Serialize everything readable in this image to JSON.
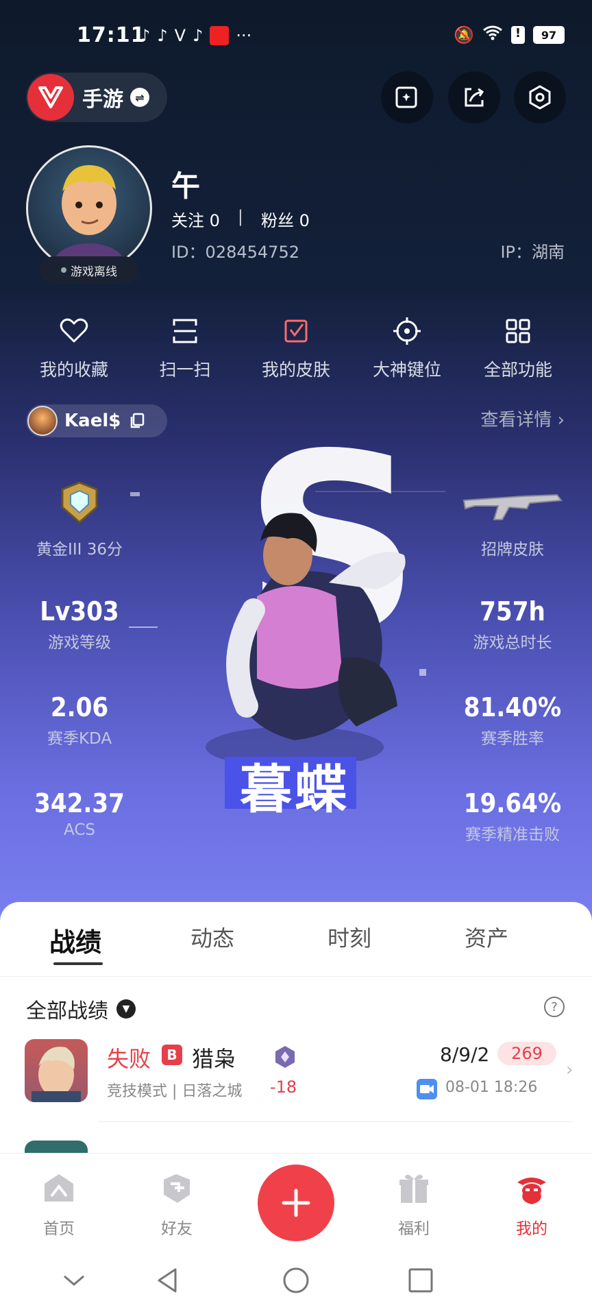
{
  "status_bar": {
    "time": "17:11",
    "battery": "97",
    "more": "···"
  },
  "header": {
    "app_name": "手游",
    "buttons": [
      "publish-icon",
      "share-icon",
      "settings-icon"
    ]
  },
  "profile": {
    "username": "午",
    "follow_label": "关注 0",
    "fans_label": "粉丝 0",
    "separator": "|",
    "id_text": "ID：028454752",
    "ip_text": "IP：湖南",
    "status": "游戏离线"
  },
  "quick_actions": [
    {
      "label": "我的收藏",
      "icon": "heart-icon"
    },
    {
      "label": "扫一扫",
      "icon": "scan-icon"
    },
    {
      "label": "我的皮肤",
      "icon": "skin-icon"
    },
    {
      "label": "大神键位",
      "icon": "crosshair-icon"
    },
    {
      "label": "全部功能",
      "icon": "grid-icon"
    }
  ],
  "account": {
    "name": "Kael$",
    "detail_link": "查看详情 ›"
  },
  "hero": {
    "agent_name": "暮蝶",
    "letter": "S"
  },
  "stats": {
    "rank_label": "黄金III 36分",
    "signature_label": "招牌皮肤",
    "level_value": "Lv303",
    "level_label": "游戏等级",
    "hours_value": "757h",
    "hours_label": "游戏总时长",
    "kda_value": "2.06",
    "kda_label": "赛季KDA",
    "winrate_value": "81.40%",
    "winrate_label": "赛季胜率",
    "acs_value": "342.37",
    "acs_label": "ACS",
    "headshot_value": "19.64%",
    "headshot_label": "赛季精准击败"
  },
  "tabs": [
    "战绩",
    "动态",
    "时刻",
    "资产"
  ],
  "records": {
    "heading": "全部战绩",
    "help": "?",
    "items": [
      {
        "result": "失败",
        "badge": "B",
        "agent": "猎枭",
        "mode": "竞技模式 | 日落之城",
        "rank_delta": "-18",
        "kda": "8/9/2",
        "acs": "269",
        "datetime": "08-01 18:26"
      }
    ]
  },
  "bottom_nav": [
    {
      "label": "首页",
      "icon": "home-icon"
    },
    {
      "label": "好友",
      "icon": "friends-icon"
    },
    {
      "label": "福利",
      "icon": "gift-icon"
    },
    {
      "label": "我的",
      "icon": "me-icon"
    }
  ],
  "colors": {
    "accent": "#e5303a",
    "loss": "#e5404a",
    "hero_bg": "#6a6ee0"
  }
}
